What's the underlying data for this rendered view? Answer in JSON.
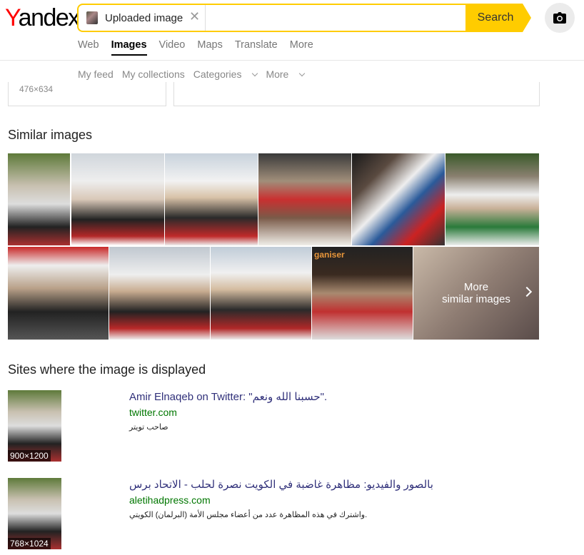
{
  "header": {
    "logo_y": "Y",
    "logo_rest": "andex",
    "search_chip_label": "Uploaded image",
    "search_button": "Search",
    "camera_icon": "camera-icon"
  },
  "nav": {
    "tabs": [
      {
        "label": "Web",
        "active": false
      },
      {
        "label": "Images",
        "active": true
      },
      {
        "label": "Video",
        "active": false
      },
      {
        "label": "Maps",
        "active": false
      },
      {
        "label": "Translate",
        "active": false
      },
      {
        "label": "More",
        "active": false
      }
    ]
  },
  "subnav": {
    "my_feed": "My feed",
    "my_collections": "My collections",
    "categories": "Categories",
    "more": "More"
  },
  "previous": {
    "dims": "476×634"
  },
  "similar": {
    "title": "Similar images",
    "more_line1": "More",
    "more_line2": "similar images"
  },
  "sites": {
    "title": "Sites where the image is displayed",
    "items": [
      {
        "title": "Amir Elnaqeb on Twitter: \"حسبنا الله ونعم\".",
        "url": "twitter.com",
        "desc": "صاحب تويتر",
        "dims": "900×1200"
      },
      {
        "title": "بالصور والفيديو: مظاهرة غاضبة في الكويت نصرة لحلب - الاتحاد برس",
        "url": "aletihadpress.com",
        "desc": "واشترك في هذه المظاهرة عدد من أعضاء مجلس الأمة (البرلمان) الكويتي.",
        "dims": "768×1024"
      }
    ]
  },
  "colors": {
    "accent": "#ffcc00",
    "logo_red": "#ff0000",
    "link": "#30307a",
    "url_green": "#007700"
  }
}
